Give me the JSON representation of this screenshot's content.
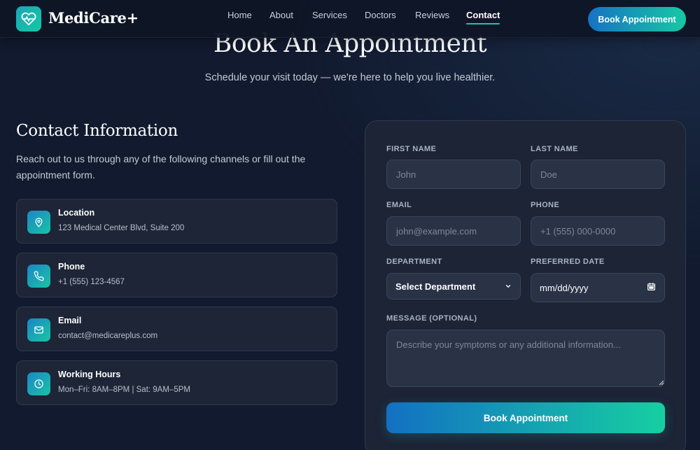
{
  "nav": {
    "brand": "MediCare+",
    "links": [
      "Home",
      "About",
      "Services",
      "Doctors",
      "Reviews",
      "Contact"
    ],
    "active": "Contact",
    "cta_label": "Book Appointment"
  },
  "hero": {
    "title": "Book An Appointment",
    "subtitle": "Schedule your visit today — we're here to help you live healthier."
  },
  "contact": {
    "title": "Contact Information",
    "description": "Reach out to us through any of the following channels or fill out the appointment form.",
    "items": [
      {
        "label": "Location",
        "value": "123 Medical Center Blvd, Suite 200",
        "icon": "map-pin-icon"
      },
      {
        "label": "Phone",
        "value": "+1 (555) 123-4567",
        "icon": "phone-icon"
      },
      {
        "label": "Email",
        "value": "contact@medicareplus.com",
        "icon": "mail-icon"
      },
      {
        "label": "Working Hours",
        "value": "Mon–Fri: 8AM–8PM | Sat: 9AM–5PM",
        "icon": "clock-icon"
      }
    ]
  },
  "form": {
    "first_name": {
      "label": "FIRST NAME",
      "placeholder": "John"
    },
    "last_name": {
      "label": "LAST NAME",
      "placeholder": "Doe"
    },
    "email": {
      "label": "EMAIL",
      "placeholder": "john@example.com"
    },
    "phone": {
      "label": "PHONE",
      "placeholder": "+1 (555) 000-0000"
    },
    "department": {
      "label": "DEPARTMENT",
      "value": "Select Department"
    },
    "date": {
      "label": "PREFERRED DATE",
      "value": "mm/dd/yyyy"
    },
    "message": {
      "label": "MESSAGE (OPTIONAL)",
      "placeholder": "Describe your symptoms or any additional information..."
    },
    "submit_label": "Book Appointment"
  },
  "colors": {
    "background": "#111a2e",
    "accent_start": "#1672c4",
    "accent_end": "#16c9a4"
  }
}
